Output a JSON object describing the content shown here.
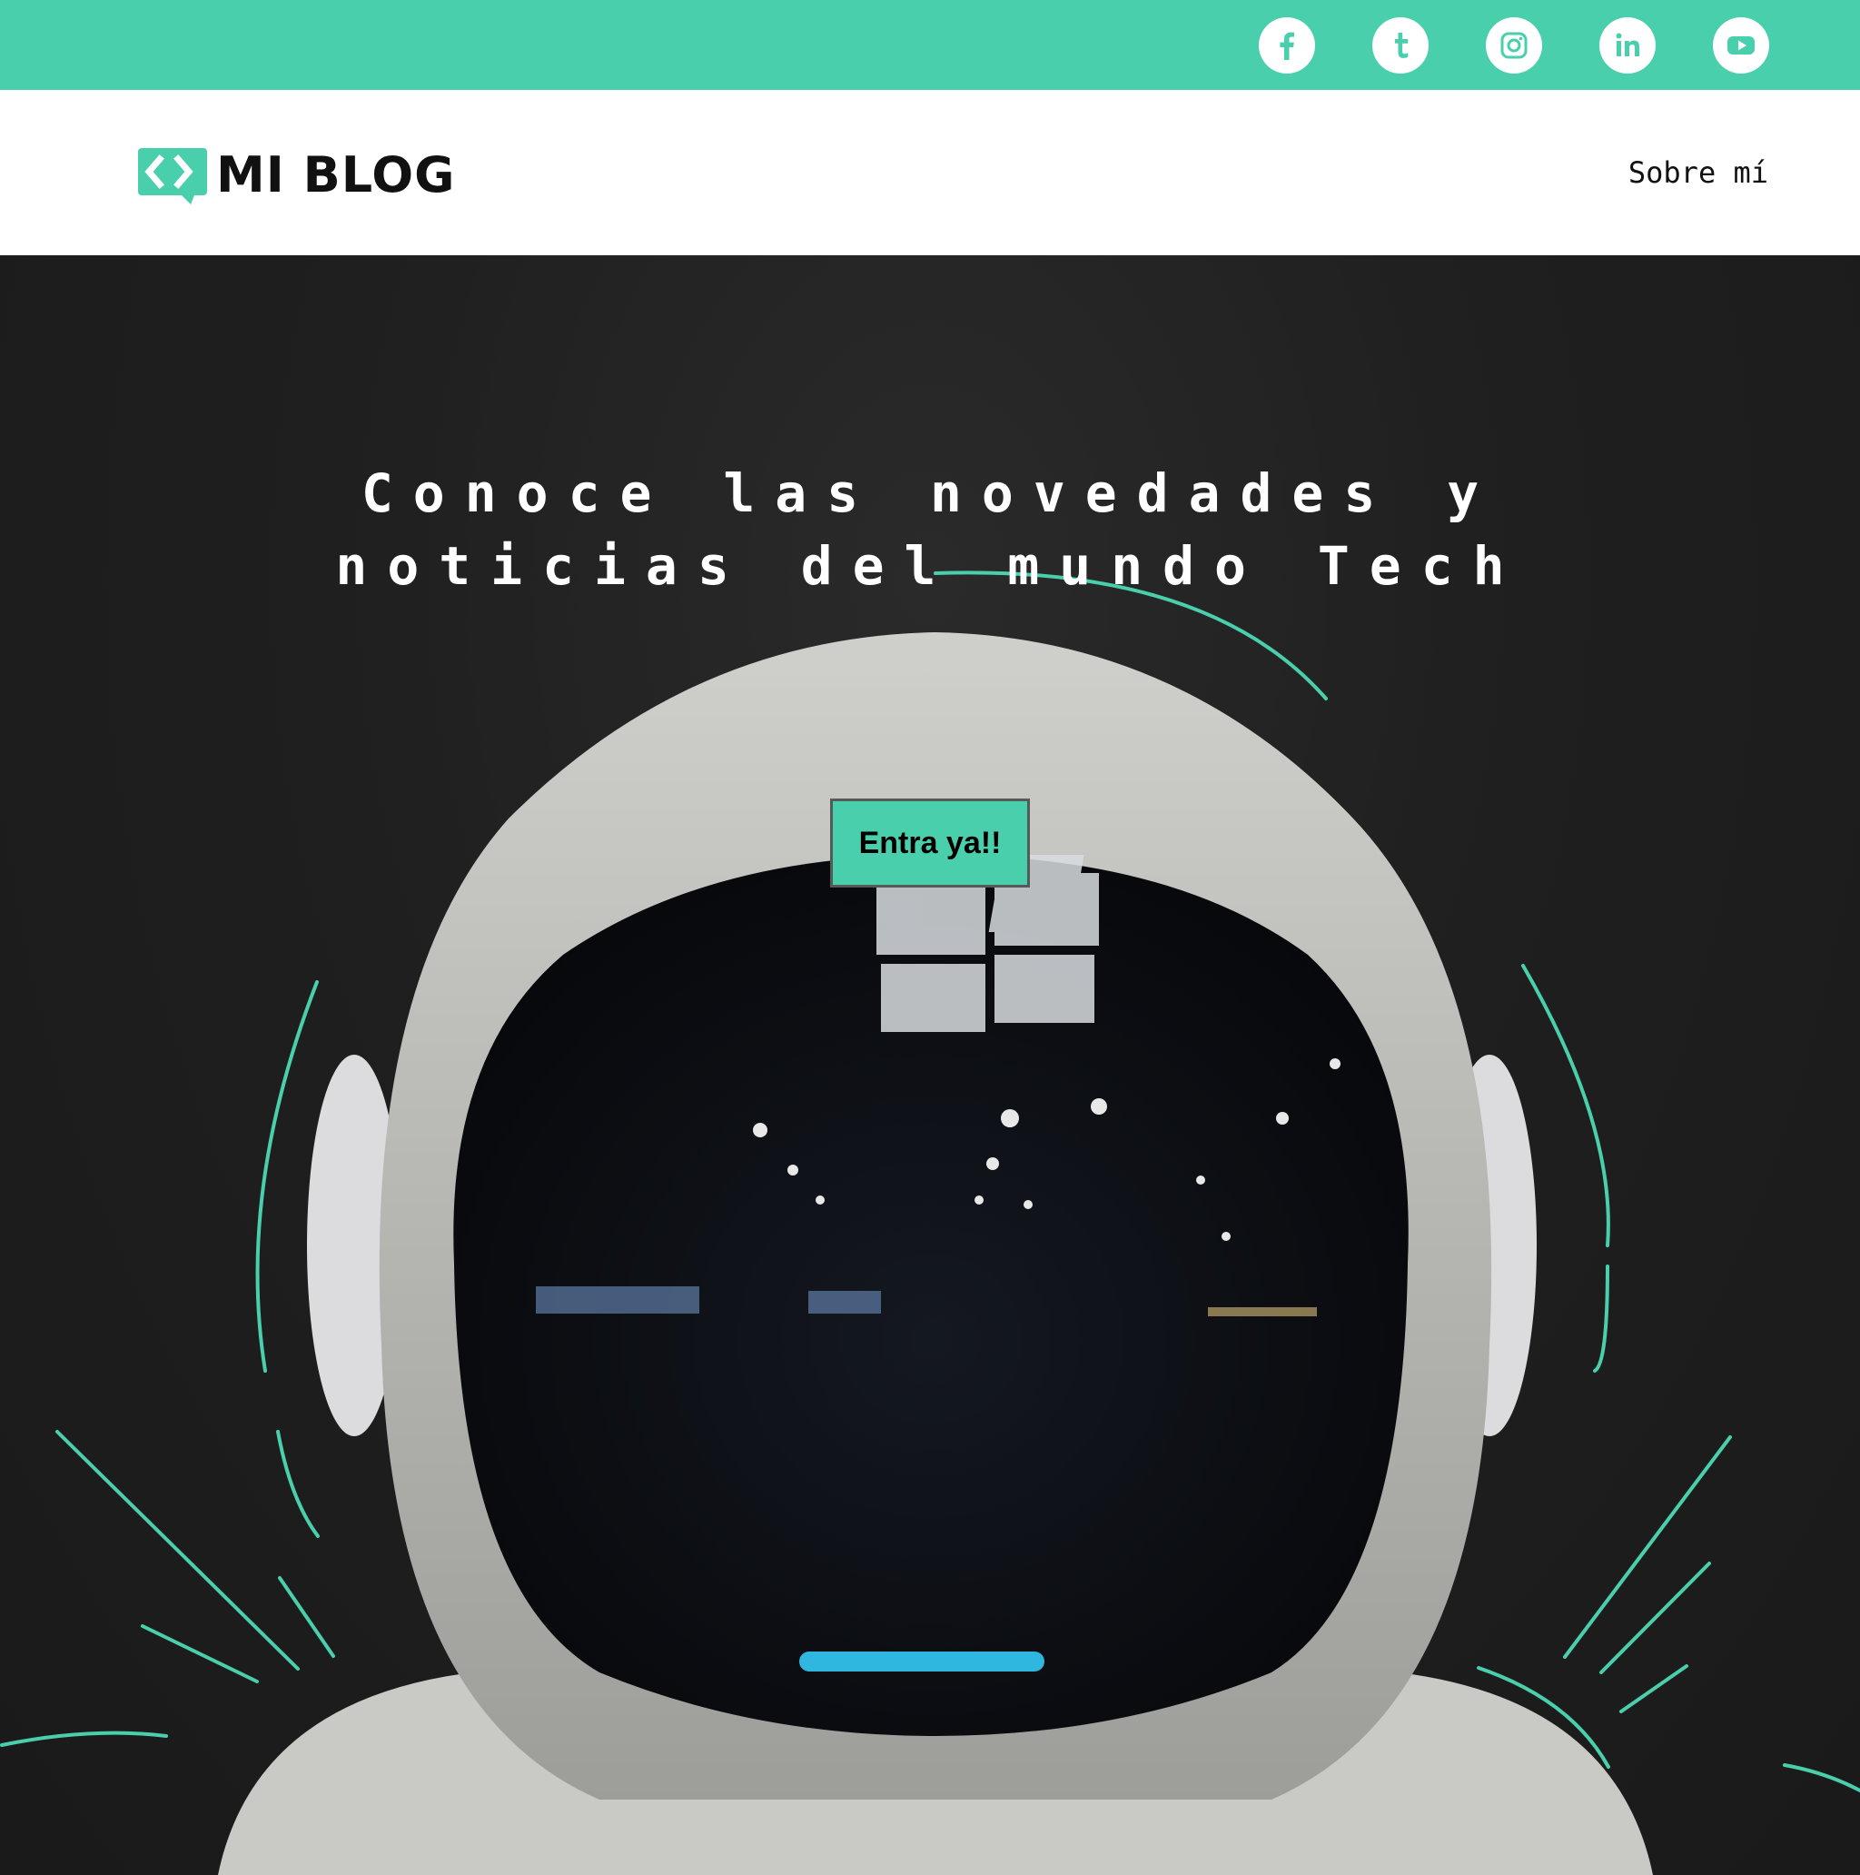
{
  "social": [
    {
      "name": "facebook-icon"
    },
    {
      "name": "tumblr-icon"
    },
    {
      "name": "instagram-icon"
    },
    {
      "name": "linkedin-icon"
    },
    {
      "name": "youtube-icon"
    }
  ],
  "header": {
    "logo_text": "MI BLOG",
    "nav": {
      "about": "Sobre mí"
    }
  },
  "hero": {
    "title": "Conoce las novedades y\nnoticias del mundo Tech",
    "cta": "Entra ya!!"
  },
  "colors": {
    "accent": "#4acfad",
    "hero_bg": "#1f1f1f",
    "text_dark": "#111111"
  }
}
